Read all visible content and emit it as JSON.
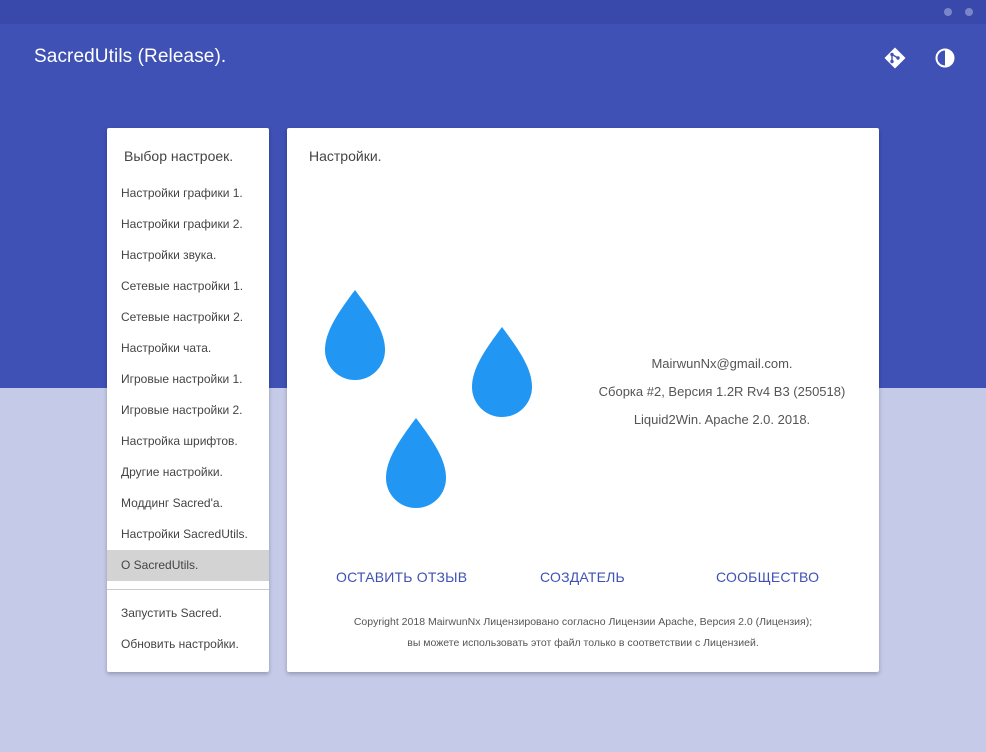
{
  "app": {
    "title": "SacredUtils (Release)."
  },
  "header_icons": [
    "git-icon",
    "contrast-icon"
  ],
  "sidebar": {
    "title": "Выбор настроек.",
    "items": [
      {
        "label": "Настройки графики 1."
      },
      {
        "label": "Настройки графики 2."
      },
      {
        "label": "Настройки звука."
      },
      {
        "label": "Сетевые настройки 1."
      },
      {
        "label": "Сетевые настройки 2."
      },
      {
        "label": "Настройки чата."
      },
      {
        "label": "Игровые настройки 1."
      },
      {
        "label": "Игровые настройки 2."
      },
      {
        "label": "Настройка шрифтов."
      },
      {
        "label": "Другие настройки."
      },
      {
        "label": "Моддинг Sacred'a."
      },
      {
        "label": "Настройки SacredUtils."
      },
      {
        "label": "O SacredUtils."
      }
    ],
    "active_index": 12,
    "actions": [
      {
        "label": "Запустить Sacred."
      },
      {
        "label": "Обновить настройки."
      }
    ]
  },
  "main": {
    "title": "Настройки.",
    "info": {
      "email": "MairwunNx@gmail.com.",
      "build": "Сборка #2, Версия 1.2R Rv4 B3 (250518)",
      "license": "Liquid2Win. Apache 2.0. 2018."
    },
    "links": {
      "feedback": "ОСТАВИТЬ ОТЗЫВ",
      "creator": "СОЗДАТЕЛЬ",
      "community": "СООБЩЕСТВО"
    },
    "copyright": {
      "line1": "Copyright 2018 MairwunNx Лицензировано согласно Лицензии Apache, Версия 2.0 (Лицензия);",
      "line2": "вы можете использовать этот файл только в соответствии с Лицензией."
    }
  },
  "colors": {
    "header": "#3f51b5",
    "titlebar": "#3949ab",
    "background": "#c5cae9",
    "accent": "#3f51b5",
    "drop": "#2196f3"
  }
}
